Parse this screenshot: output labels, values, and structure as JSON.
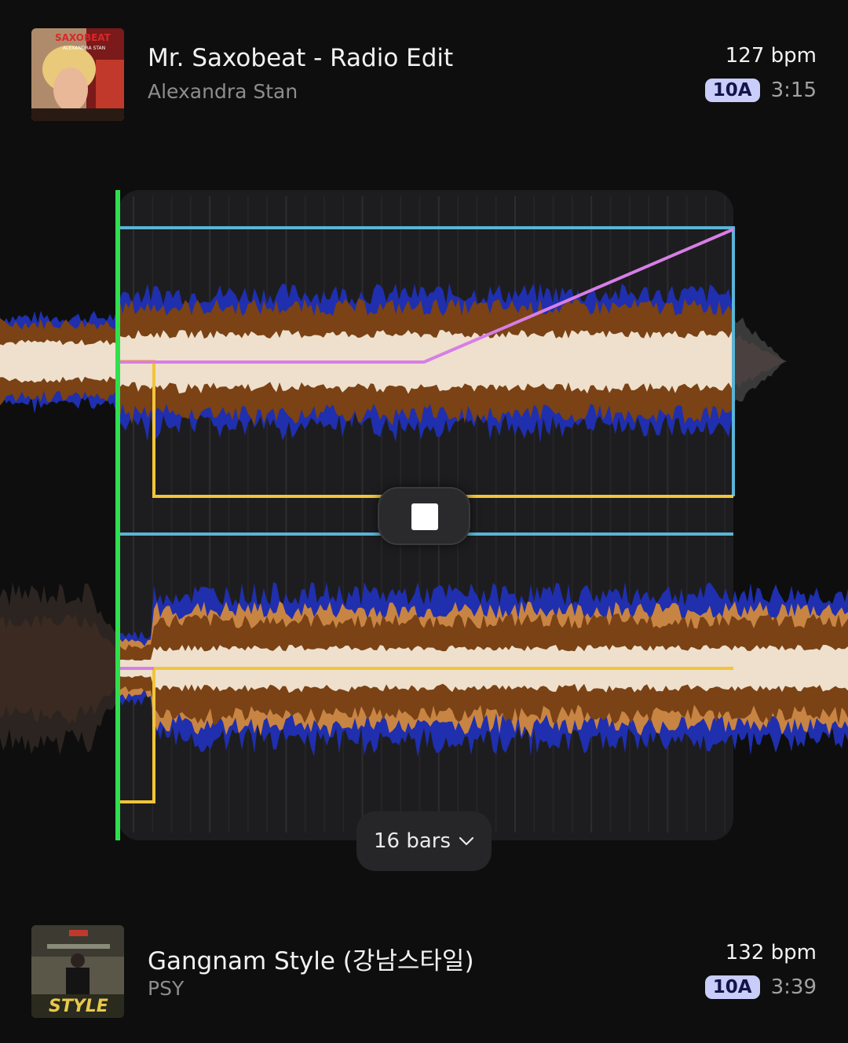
{
  "tracks": [
    {
      "title": "Mr. Saxobeat - Radio Edit",
      "artist": "Alexandra Stan",
      "bpm": "127 bpm",
      "key": "10A",
      "duration": "3:15",
      "cover_text": "SAXOBEAT",
      "cover_subtext": "ALEXANDRA STAN"
    },
    {
      "title": "Gangnam Style (강남스타일)",
      "artist": "PSY",
      "bpm": "132 bpm",
      "key": "10A",
      "duration": "3:39",
      "cover_text": "STYLE"
    }
  ],
  "transition": {
    "length_label": "16 bars",
    "stop_icon": "stop-icon",
    "dropdown_icon": "chevron-down-icon"
  },
  "colors": {
    "background": "#0e0e0e",
    "start_marker": "#2ee04c",
    "volume_line": "#5ab4d6",
    "eq_line": "#f2c43a",
    "filter_line": "#d77ee6",
    "wave_low": "#1f2fae",
    "wave_mid": "#7a4215",
    "wave_mid_light": "#c88442",
    "wave_high": "#eee0cc",
    "key_badge": "#c9cdf9"
  }
}
